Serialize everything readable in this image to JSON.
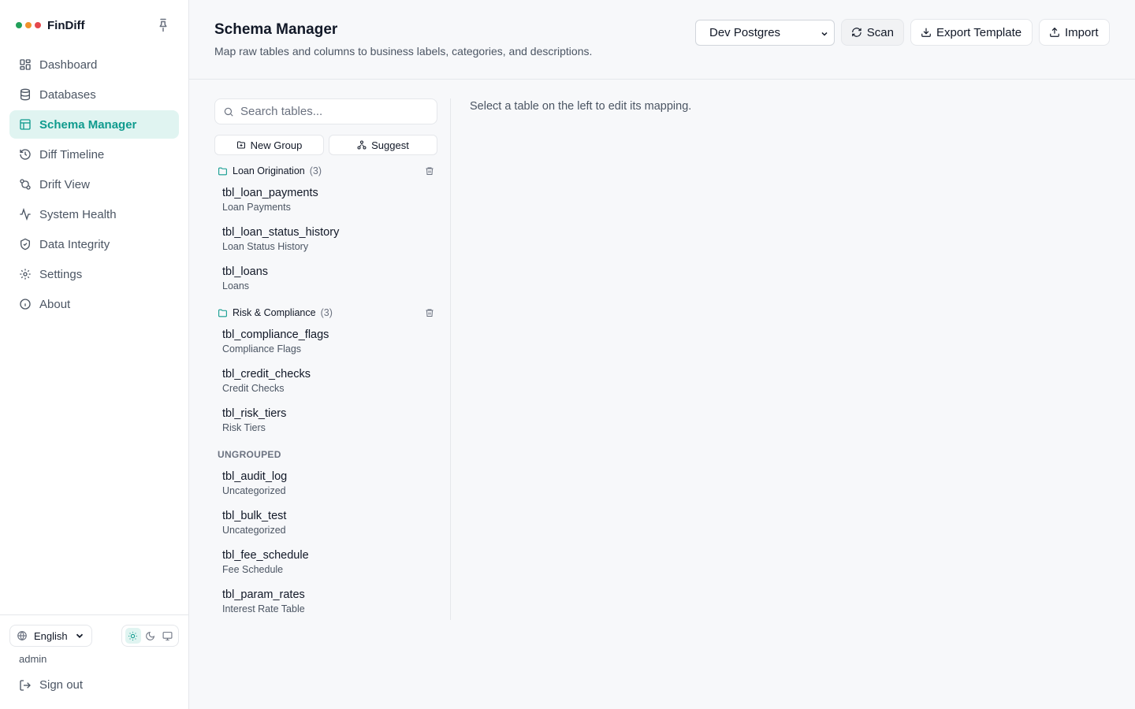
{
  "app": {
    "name": "FinDiff",
    "dot_colors": [
      "#22a05a",
      "#f0922b",
      "#e5484d"
    ]
  },
  "nav": [
    {
      "label": "Dashboard",
      "icon": "dashboard-icon"
    },
    {
      "label": "Databases",
      "icon": "database-icon"
    },
    {
      "label": "Schema Manager",
      "icon": "table-icon",
      "active": true
    },
    {
      "label": "Diff Timeline",
      "icon": "history-icon"
    },
    {
      "label": "Drift View",
      "icon": "git-compare-icon"
    },
    {
      "label": "System Health",
      "icon": "activity-icon"
    },
    {
      "label": "Data Integrity",
      "icon": "shield-icon"
    },
    {
      "label": "Settings",
      "icon": "gear-icon"
    },
    {
      "label": "About",
      "icon": "info-icon"
    }
  ],
  "footer": {
    "language": "English",
    "user": "admin",
    "sign_out": "Sign out",
    "theme_selected": "light"
  },
  "header": {
    "title": "Schema Manager",
    "subtitle": "Map raw tables and columns to business labels, categories, and descriptions.",
    "database": "Dev Postgres",
    "scan": "Scan",
    "export": "Export Template",
    "import": "Import"
  },
  "search": {
    "placeholder": "Search tables..."
  },
  "actions": {
    "new_group": "New Group",
    "suggest": "Suggest"
  },
  "groups": [
    {
      "name": "Loan Origination",
      "count": "(3)",
      "tables": [
        {
          "name": "tbl_loan_payments",
          "label": "Loan Payments"
        },
        {
          "name": "tbl_loan_status_history",
          "label": "Loan Status History"
        },
        {
          "name": "tbl_loans",
          "label": "Loans"
        }
      ]
    },
    {
      "name": "Risk & Compliance",
      "count": "(3)",
      "tables": [
        {
          "name": "tbl_compliance_flags",
          "label": "Compliance Flags"
        },
        {
          "name": "tbl_credit_checks",
          "label": "Credit Checks"
        },
        {
          "name": "tbl_risk_tiers",
          "label": "Risk Tiers"
        }
      ]
    }
  ],
  "ungrouped": {
    "heading": "UNGROUPED",
    "tables": [
      {
        "name": "tbl_audit_log",
        "label": "Uncategorized"
      },
      {
        "name": "tbl_bulk_test",
        "label": "Uncategorized"
      },
      {
        "name": "tbl_fee_schedule",
        "label": "Fee Schedule"
      },
      {
        "name": "tbl_param_rates",
        "label": "Interest Rate Table"
      }
    ]
  },
  "detail": {
    "empty_message": "Select a table on the left to edit its mapping."
  },
  "colors": {
    "accent": "#0f9b8e",
    "accent_bg": "#e0f4f1"
  }
}
